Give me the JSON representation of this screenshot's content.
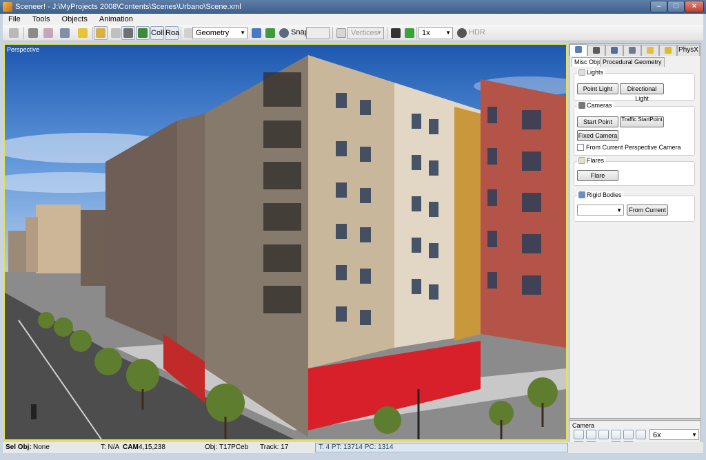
{
  "window": {
    "title": "Sceneer! - J:\\MyProjects 2008\\Contents\\Scenes\\Urbano\\Scene.xml"
  },
  "menu": [
    "File",
    "Tools",
    "Objects",
    "Animation"
  ],
  "toolbar": {
    "coll_label": "Coll",
    "roa_label": "Roa",
    "mode_select": "Geometry",
    "snap_label": "Snap",
    "vertices_select": "Vertices",
    "speed_select": "1x",
    "hdr_label": "HDR"
  },
  "viewport": {
    "label": "Perspective"
  },
  "panel": {
    "top_tabs_last": "PhysX",
    "subtabs": [
      "Misc Objs",
      "Procedural Geometry"
    ],
    "lights": {
      "title": "Lights",
      "point_light": "Point Light",
      "directional_light": "Directional Light"
    },
    "cameras": {
      "title": "Cameras",
      "start_point": "Start Point",
      "traffic_start_point": "Traffic StartPoint",
      "fixed_camera": "Fixed Camera",
      "from_perspective": "From Current Perspective Camera"
    },
    "flares": {
      "title": "Flares",
      "flare": "Flare"
    },
    "rigid_bodies": {
      "title": "Rigid Bodies",
      "from_current": "From Current"
    }
  },
  "camera_panel": {
    "title": "Camera",
    "zoom_select": "6x"
  },
  "status": {
    "sel_obj_label": "Sel Obj:",
    "sel_obj_value": "None",
    "t_value": "T: N/A",
    "cam_label": "CAM",
    "cam_value": "4,15,238",
    "obj_value": "Obj: T17PCeb",
    "track_value": "Track: 17",
    "stats": "T: 4 PT: 13714 PC: 1314"
  },
  "colors": {
    "accent": "#e8e04c",
    "titlebar": "#3d5f8c"
  }
}
